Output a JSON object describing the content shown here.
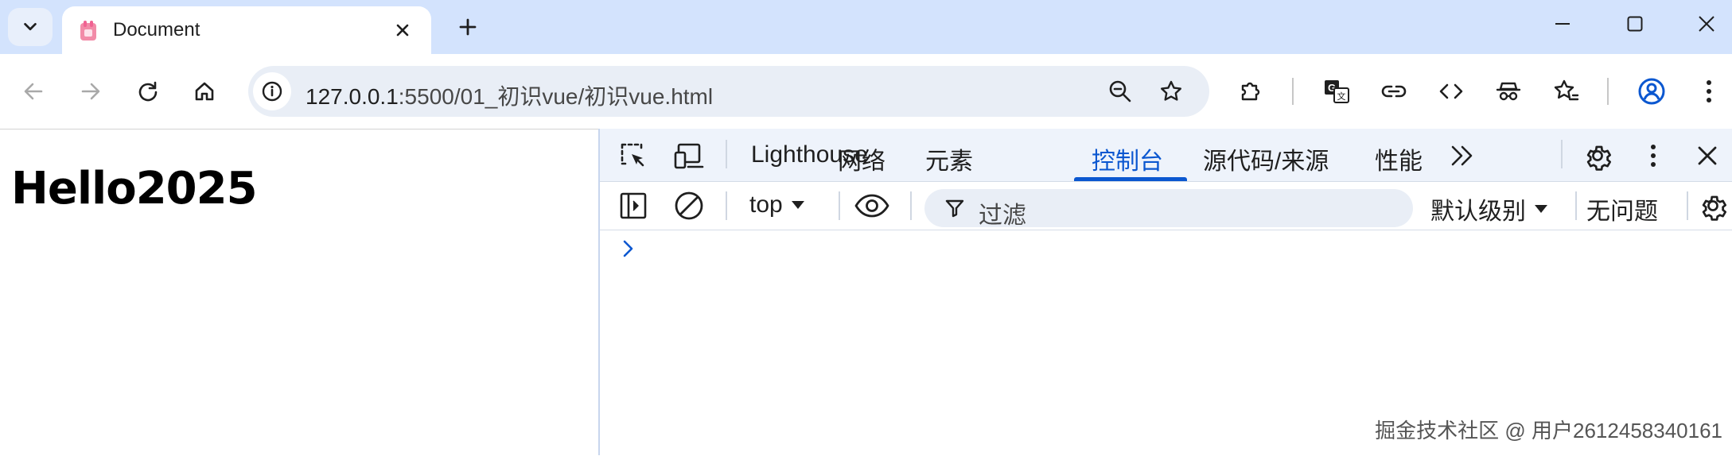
{
  "tabstrip": {
    "tab_title": "Document"
  },
  "toolbar": {
    "url_host": "127.0.0.1",
    "url_path": ":5500/01_初识vue/初识vue.html"
  },
  "page": {
    "heading": "Hello2025"
  },
  "devtools": {
    "tabs": [
      {
        "label": "Lighthouse"
      },
      {
        "label": "网络"
      },
      {
        "label": "元素"
      },
      {
        "label": "控制台"
      },
      {
        "label": "源代码/来源"
      },
      {
        "label": "性能"
      }
    ],
    "active_tab": "控制台",
    "console": {
      "context": "top",
      "filter_placeholder": "过滤",
      "levels": "默认级别",
      "issues": "无问题"
    }
  },
  "watermark": "掘金技术社区 @ 用户2612458340161",
  "colors": {
    "tabstrip_bg": "#d3e3fd",
    "accent": "#0b57d0",
    "omnibox_bg": "#e9eef6",
    "profile_icon": "#0b57d0"
  }
}
